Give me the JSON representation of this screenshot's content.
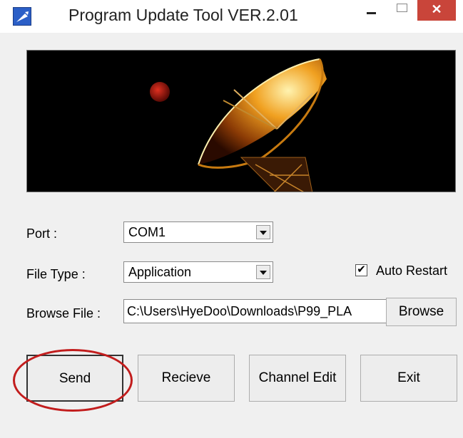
{
  "window": {
    "title": "Program Update Tool VER.2.01",
    "close_glyph": "✕",
    "icons": [
      "app-icon",
      "minimize-icon",
      "maximize-icon",
      "close-icon"
    ]
  },
  "form": {
    "port": {
      "label": "Port :",
      "value": "COM1"
    },
    "file_type": {
      "label": "File Type :",
      "value": "Application"
    },
    "auto_restart": {
      "label": "Auto Restart",
      "checked": true,
      "check_glyph": "✔"
    },
    "browse_file": {
      "label": "Browse File :",
      "value": "C:\\Users\\HyeDoo\\Downloads\\P99_PLA"
    },
    "browse_button": "Browse"
  },
  "buttons": {
    "send": "Send",
    "receive": "Recieve",
    "channel_edit": "Channel Edit",
    "exit": "Exit"
  },
  "colors": {
    "close_button": "#c9453a",
    "highlight_ellipse": "#c21d1d",
    "banner_background": "#000000"
  }
}
